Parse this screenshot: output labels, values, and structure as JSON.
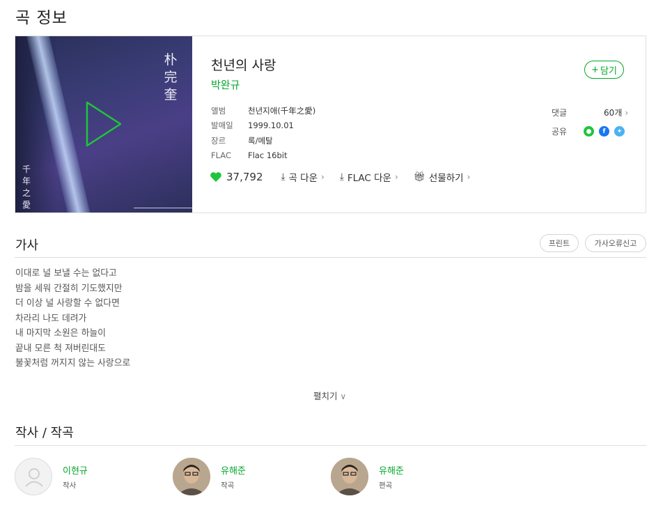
{
  "page_title": "곡 정보",
  "song": {
    "title": "천년의 사랑",
    "artist": "박완규",
    "add_label": "담기",
    "cover_text": {
      "top": [
        "朴",
        "完",
        "奎"
      ],
      "bottom": [
        "千",
        "年",
        "之",
        "愛"
      ]
    },
    "meta": [
      {
        "key": "앨범",
        "value": "천년지애(千年之愛)"
      },
      {
        "key": "발매일",
        "value": "1999.10.01"
      },
      {
        "key": "장르",
        "value": "록/메탈"
      },
      {
        "key": "FLAC",
        "value": "Flac 16bit"
      }
    ],
    "comments_label": "댓글",
    "comments_count": "60개",
    "share_label": "공유",
    "share_icons": [
      "melon-friend-icon",
      "facebook-icon",
      "twitter-icon"
    ],
    "likes": "37,792",
    "actions": [
      "곡 다운",
      "FLAC 다운",
      "선물하기"
    ]
  },
  "lyrics": {
    "title": "가사",
    "print_label": "프린트",
    "report_label": "가사오류신고",
    "lines": [
      "이대로 널 보낼 수는 없다고",
      "밤을 세워 간절히 기도했지만",
      "더 이상 널 사랑할 수 없다면",
      "차라리 나도 데려가",
      "내 마지막 소원은 하늘이",
      "끝내 모른 척 져버린대도",
      "불꽃처럼 꺼지지 않는 사랑으로"
    ],
    "expand_label": "펼치기"
  },
  "credits": {
    "title": "작사 / 작곡",
    "people": [
      {
        "name": "이현규",
        "role": "작사",
        "photo": false
      },
      {
        "name": "유해준",
        "role": "작곡",
        "photo": true
      },
      {
        "name": "유해준",
        "role": "편곡",
        "photo": true
      }
    ]
  },
  "colors": {
    "accent": "#00a829",
    "heart": "#1fc53b",
    "facebook": "#1877f2",
    "twitter": "#4ab3f4"
  }
}
